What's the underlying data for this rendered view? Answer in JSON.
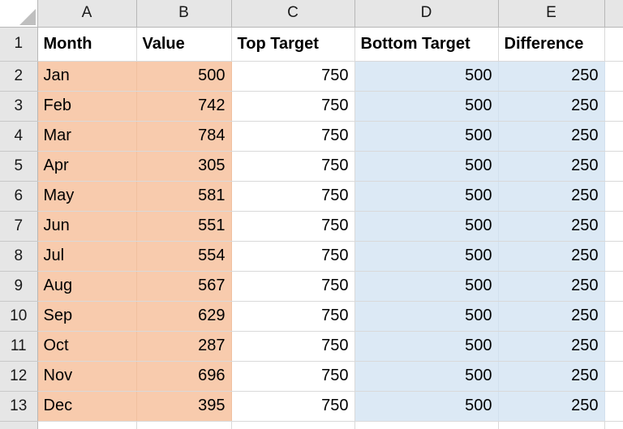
{
  "app": {
    "type": "spreadsheet",
    "select_all_icon": "select-all-triangle-icon"
  },
  "columns": {
    "headers": [
      "A",
      "B",
      "C",
      "D",
      "E"
    ]
  },
  "rows": {
    "numbers": [
      "1",
      "2",
      "3",
      "4",
      "5",
      "6",
      "7",
      "8",
      "9",
      "10",
      "11",
      "12",
      "13"
    ]
  },
  "colors": {
    "fill_orange": "#F8CBAD",
    "fill_blue": "#DCE9F5",
    "header_gray": "#E6E6E6",
    "gridline": "#D9D9D9",
    "header_border": "#B7B7B7"
  },
  "table": {
    "column_headers": [
      "Month",
      "Value",
      "Top Target",
      "Bottom Target",
      "Difference"
    ],
    "rows": [
      {
        "month": "Jan",
        "value": "500",
        "top_target": "750",
        "bottom_target": "500",
        "difference": "250"
      },
      {
        "month": "Feb",
        "value": "742",
        "top_target": "750",
        "bottom_target": "500",
        "difference": "250"
      },
      {
        "month": "Mar",
        "value": "784",
        "top_target": "750",
        "bottom_target": "500",
        "difference": "250"
      },
      {
        "month": "Apr",
        "value": "305",
        "top_target": "750",
        "bottom_target": "500",
        "difference": "250"
      },
      {
        "month": "May",
        "value": "581",
        "top_target": "750",
        "bottom_target": "500",
        "difference": "250"
      },
      {
        "month": "Jun",
        "value": "551",
        "top_target": "750",
        "bottom_target": "500",
        "difference": "250"
      },
      {
        "month": "Jul",
        "value": "554",
        "top_target": "750",
        "bottom_target": "500",
        "difference": "250"
      },
      {
        "month": "Aug",
        "value": "567",
        "top_target": "750",
        "bottom_target": "500",
        "difference": "250"
      },
      {
        "month": "Sep",
        "value": "629",
        "top_target": "750",
        "bottom_target": "500",
        "difference": "250"
      },
      {
        "month": "Oct",
        "value": "287",
        "top_target": "750",
        "bottom_target": "500",
        "difference": "250"
      },
      {
        "month": "Nov",
        "value": "696",
        "top_target": "750",
        "bottom_target": "500",
        "difference": "250"
      },
      {
        "month": "Dec",
        "value": "395",
        "top_target": "750",
        "bottom_target": "500",
        "difference": "250"
      }
    ]
  }
}
